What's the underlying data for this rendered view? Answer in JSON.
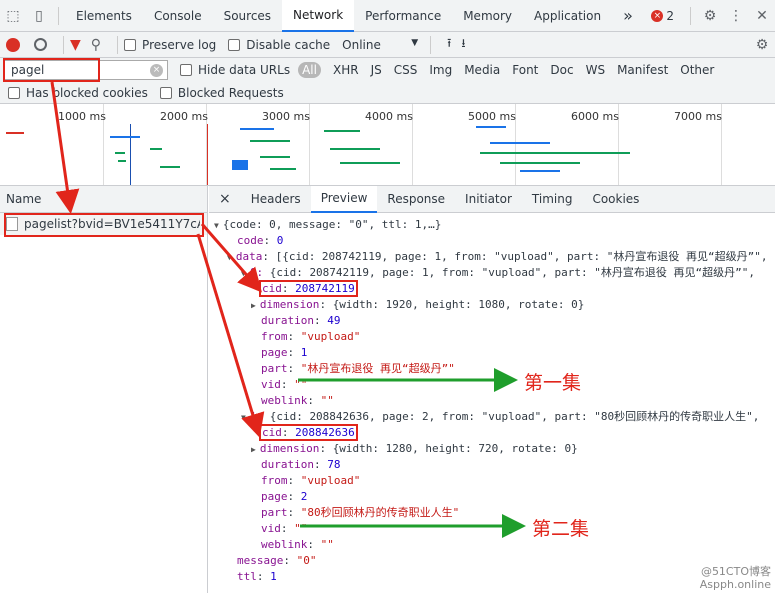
{
  "devtools": {
    "tabs": [
      "Elements",
      "Console",
      "Sources",
      "Network",
      "Performance",
      "Memory",
      "Application"
    ],
    "more": "»",
    "error_count": "2"
  },
  "toolbar": {
    "preserve_log": "Preserve log",
    "disable_cache": "Disable cache",
    "throttle": "Online"
  },
  "filter": {
    "value": "pagel",
    "hide_data_urls": "Hide data URLs",
    "all": "All",
    "types": [
      "XHR",
      "JS",
      "CSS",
      "Img",
      "Media",
      "Font",
      "Doc",
      "WS",
      "Manifest",
      "Other"
    ],
    "has_blocked": "Has blocked cookies",
    "blocked_requests": "Blocked Requests"
  },
  "overview": {
    "ticks": [
      "1000 ms",
      "2000 ms",
      "3000 ms",
      "4000 ms",
      "5000 ms",
      "6000 ms",
      "7000 ms"
    ]
  },
  "requests": {
    "header": "Name",
    "items": [
      "pagelist?bvid=BV1e5411Y7cA&..."
    ]
  },
  "detail": {
    "close": "×",
    "tabs": [
      "Headers",
      "Preview",
      "Response",
      "Initiator",
      "Timing",
      "Cookies"
    ]
  },
  "json": {
    "root": "{code: 0, message: \"0\", ttl: 1,…}",
    "code_key": "code",
    "code_val": "0",
    "data_key": "data",
    "data_summary": "[{cid: 208742119, page: 1, from: \"vupload\", part: \"林丹宣布退役  再见“超级丹”\",",
    "item0_summary": "{cid: 208742119, page: 1, from: \"vupload\", part: \"林丹宣布退役  再见“超级丹”\",",
    "item0_idx": "0:",
    "item0": {
      "cid": "208742119",
      "dimension": "{width: 1920, height: 1080, rotate: 0}",
      "duration": "49",
      "from": "\"vupload\"",
      "page": "1",
      "part": "\"林丹宣布退役    再见“超级丹”\"",
      "vid": "\"\"",
      "weblink": "\"\""
    },
    "item1_idx": "1:",
    "item1_summary": "{cid: 208842636, page: 2, from: \"vupload\", part: \"80秒回顾林丹的传奇职业人生\",",
    "item1": {
      "cid": "208842636",
      "dimension": "{width: 1280, height: 720, rotate: 0}",
      "duration": "78",
      "from": "\"vupload\"",
      "page": "2",
      "part": "\"80秒回顾林丹的传奇职业人生\"",
      "vid": "\"\"",
      "weblink": "\"\""
    },
    "message_val": "\"0\"",
    "ttl_val": "1"
  },
  "annotations": {
    "ep1": "第一集",
    "ep2": "第二集"
  },
  "watermark": "@51CTO博客",
  "site": "Aspph.online"
}
